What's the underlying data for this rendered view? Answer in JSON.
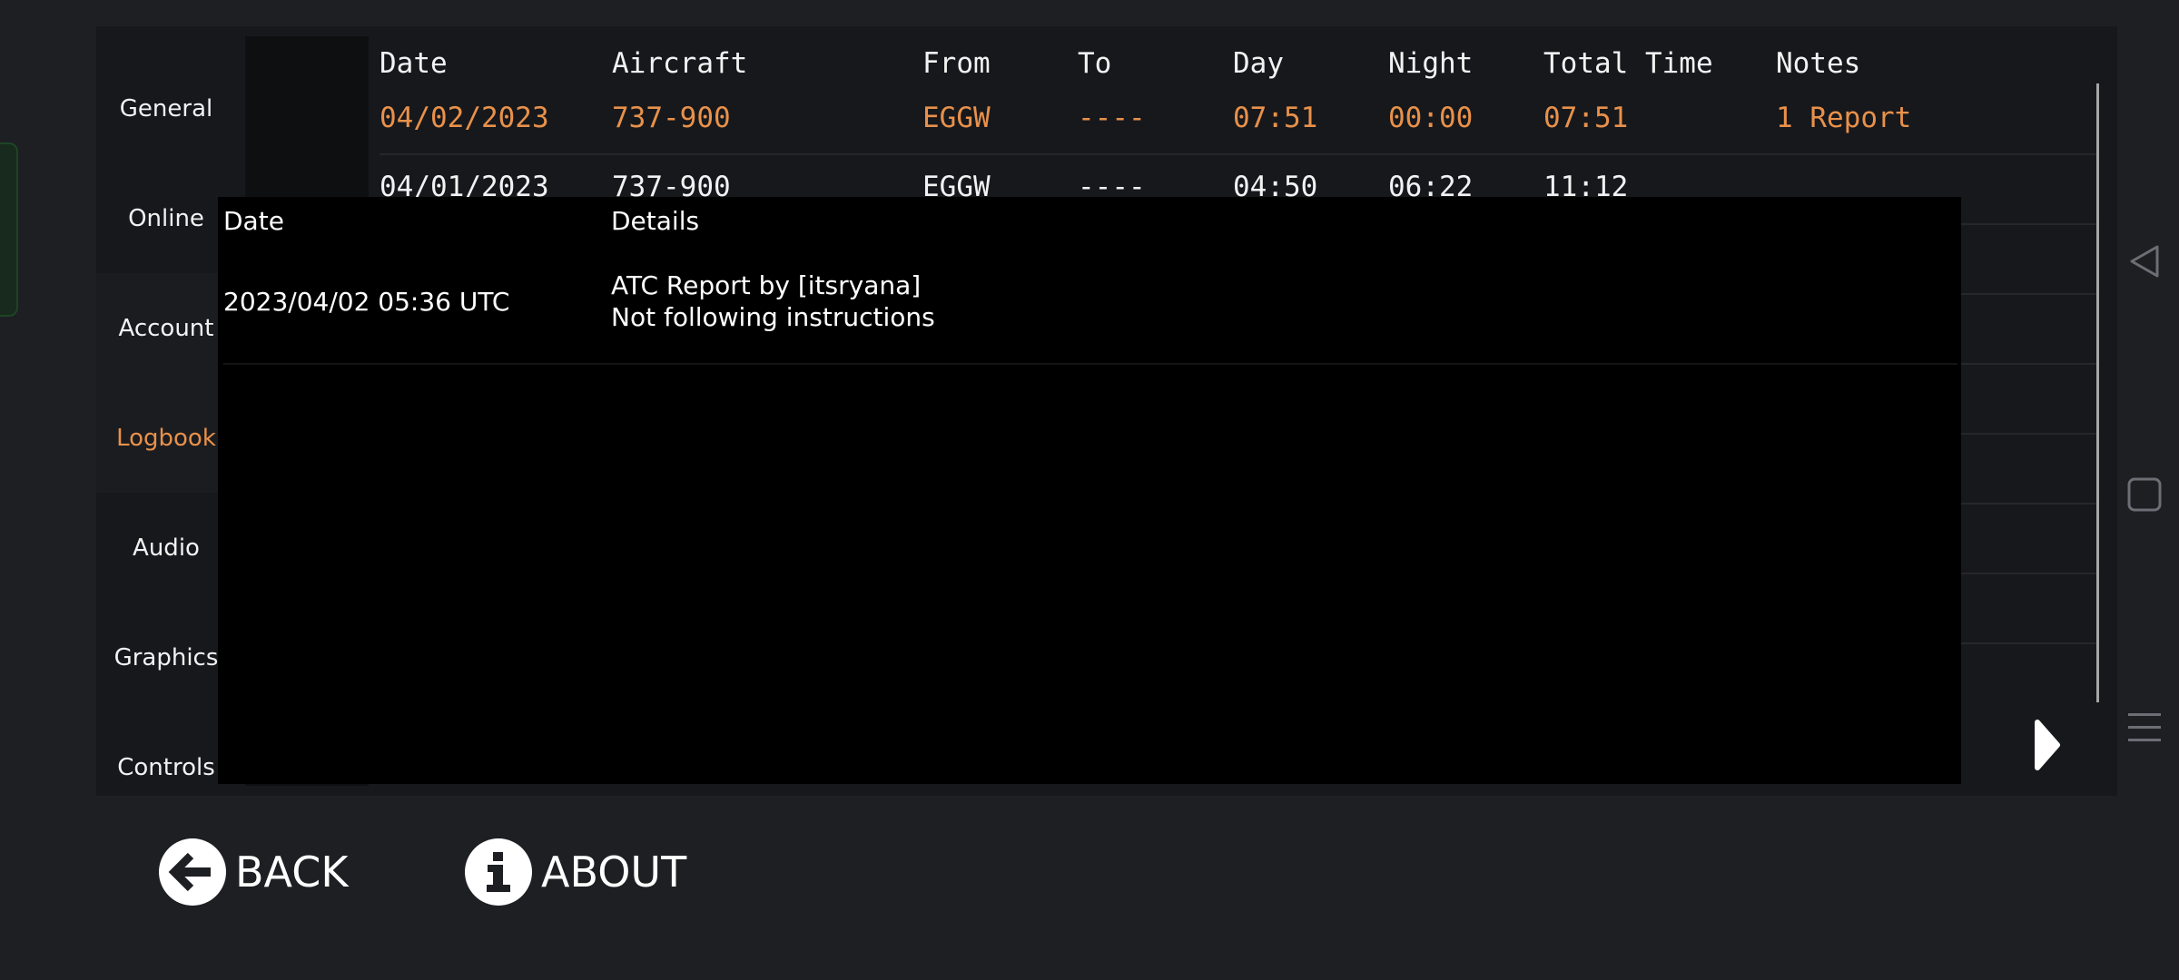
{
  "sidebar": {
    "items": [
      {
        "label": "General"
      },
      {
        "label": "Online"
      },
      {
        "label": "Account"
      },
      {
        "label": "Logbook",
        "active": true
      },
      {
        "label": "Audio"
      },
      {
        "label": "Graphics"
      },
      {
        "label": "Controls"
      }
    ]
  },
  "logbook": {
    "headers": [
      "Date",
      "Aircraft",
      "From",
      "To",
      "Day",
      "Night",
      "Total Time",
      "Notes"
    ],
    "rows": [
      {
        "date": "04/02/2023",
        "aircraft": "737-900",
        "from": "EGGW",
        "to": "----",
        "day": "07:51",
        "night": "00:00",
        "total": "07:51",
        "notes": "1 Report",
        "highlight": true
      },
      {
        "date": "04/01/2023",
        "aircraft": "737-900",
        "from": "EGGW",
        "to": "----",
        "day": "04:50",
        "night": "06:22",
        "total": "11:12",
        "notes": "",
        "highlight": false
      }
    ]
  },
  "report_popup": {
    "headers": {
      "date": "Date",
      "details": "Details"
    },
    "entries": [
      {
        "date": "2023/04/02 05:36 UTC",
        "details_line1": "ATC Report by [itsryana]",
        "details_line2": "Not following instructions"
      }
    ]
  },
  "footer": {
    "back_label": "BACK",
    "about_label": "ABOUT",
    "back_icon": "arrow-left-icon",
    "about_icon": "info-icon"
  },
  "colors": {
    "accent": "#e8914a",
    "background": "#1d1f23",
    "panel": "#17181c"
  }
}
